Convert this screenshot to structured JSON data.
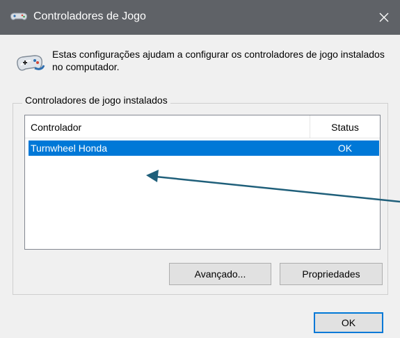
{
  "window": {
    "title": "Controladores de Jogo",
    "close_glyph": "✕"
  },
  "intro": {
    "text": "Estas configurações ajudam a configurar os controladores de jogo instalados no computador."
  },
  "group": {
    "label": "Controladores de jogo instalados"
  },
  "list": {
    "columns": [
      "Controlador",
      "Status"
    ],
    "rows": [
      {
        "name": "Turnwheel Honda",
        "status": "OK",
        "selected": true
      }
    ]
  },
  "buttons": {
    "advanced": "Avançado...",
    "properties": "Propriedades",
    "ok": "OK"
  },
  "colors": {
    "titlebar": "#5f6267",
    "selection": "#0078d7",
    "annotation_arrow": "#1f5f7a"
  },
  "icons": {
    "title": "gamepad-icon",
    "intro": "gamepad-icon",
    "close": "close-icon"
  }
}
